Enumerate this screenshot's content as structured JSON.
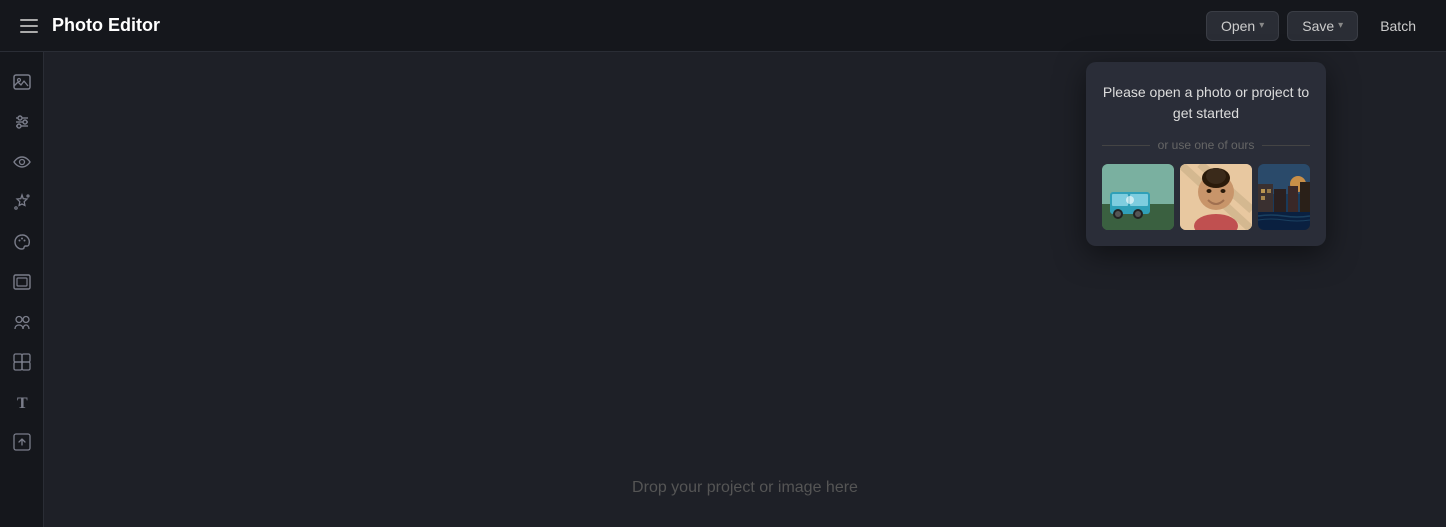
{
  "header": {
    "menu_icon_label": "menu",
    "title": "Photo Editor",
    "open_button": "Open",
    "save_button": "Save",
    "batch_button": "Batch"
  },
  "sidebar": {
    "icons": [
      {
        "name": "image-icon",
        "symbol": "🖼",
        "label": "Image"
      },
      {
        "name": "adjustments-icon",
        "symbol": "⚙",
        "label": "Adjustments"
      },
      {
        "name": "eye-icon",
        "symbol": "👁",
        "label": "View"
      },
      {
        "name": "effects-icon",
        "symbol": "✦",
        "label": "Effects"
      },
      {
        "name": "palette-icon",
        "symbol": "🎨",
        "label": "Color"
      },
      {
        "name": "frame-icon",
        "symbol": "▭",
        "label": "Frame"
      },
      {
        "name": "faces-icon",
        "symbol": "⊞",
        "label": "Faces"
      },
      {
        "name": "smart-icon",
        "symbol": "✦",
        "label": "Smart"
      },
      {
        "name": "text-icon",
        "symbol": "T",
        "label": "Text"
      },
      {
        "name": "export-icon",
        "symbol": "⊡",
        "label": "Export"
      }
    ]
  },
  "popup": {
    "title": "Please open a photo or project to get started",
    "divider_text": "or use one of ours",
    "images": [
      {
        "name": "van-thumbnail",
        "alt": "VW Van"
      },
      {
        "name": "person-thumbnail",
        "alt": "Person smiling"
      },
      {
        "name": "canal-thumbnail",
        "alt": "Canal scene"
      }
    ]
  },
  "canvas": {
    "drop_text": "Drop your project or image here"
  }
}
